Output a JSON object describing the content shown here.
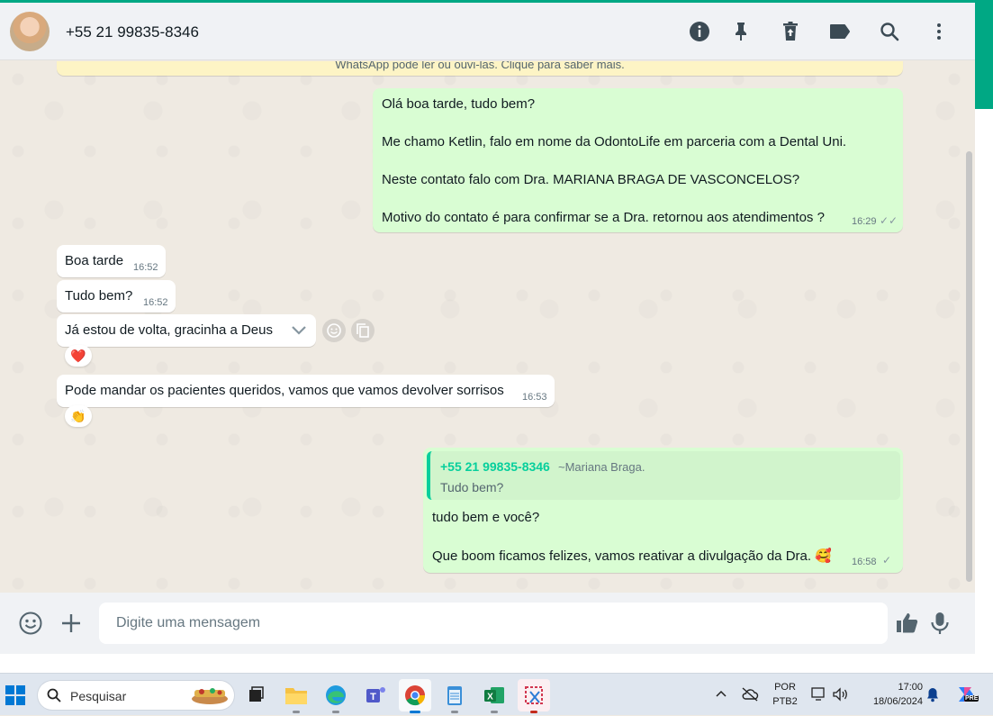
{
  "header": {
    "contact": "+55 21 99835-8346",
    "icons": [
      "info-icon",
      "pin-icon",
      "delete-icon",
      "label-icon",
      "search-icon",
      "menu-icon"
    ]
  },
  "banner": {
    "text": "WhatsApp pode ler ou ouvi-las. Clique para saber mais."
  },
  "messages": {
    "m1": {
      "lines": [
        "Olá boa tarde, tudo bem?",
        "Me chamo Ketlin, falo em nome da OdontoLife em parceria com a Dental Uni.",
        "Neste contato falo com Dra. MARIANA BRAGA DE VASCONCELOS?",
        "Motivo do contato é para confirmar se a Dra. retornou aos atendimentos ?"
      ],
      "time": "16:29"
    },
    "m2": {
      "text": "Boa tarde",
      "time": "16:52"
    },
    "m3": {
      "text": "Tudo bem?",
      "time": "16:52"
    },
    "m4": {
      "text": "Já estou de volta, gracinha a Deus",
      "reaction": "❤️"
    },
    "m5": {
      "text": "Pode mandar os pacientes queridos, vamos que vamos devolver sorrisos",
      "time": "16:53",
      "reaction": "👏"
    },
    "m6": {
      "quote_name": "+55 21 99835-8346",
      "quote_push": "~Mariana Braga.",
      "quote_text": "Tudo bem?",
      "lines": [
        "tudo bem e você?",
        "Que boom ficamos felizes, vamos reativar a divulgação da Dra. 🥰"
      ],
      "time": "16:58"
    }
  },
  "composer": {
    "placeholder": "Digite uma mensagem"
  },
  "taskbar": {
    "search_label": "Pesquisar",
    "lang_top": "POR",
    "lang_bottom": "PTB2",
    "time": "17:00",
    "date": "18/06/2024",
    "copilot_badge": "PRE"
  },
  "colors": {
    "accent": "#00a884",
    "outgoing": "#d9fdd3",
    "incoming": "#ffffff",
    "background": "#efeae2"
  }
}
